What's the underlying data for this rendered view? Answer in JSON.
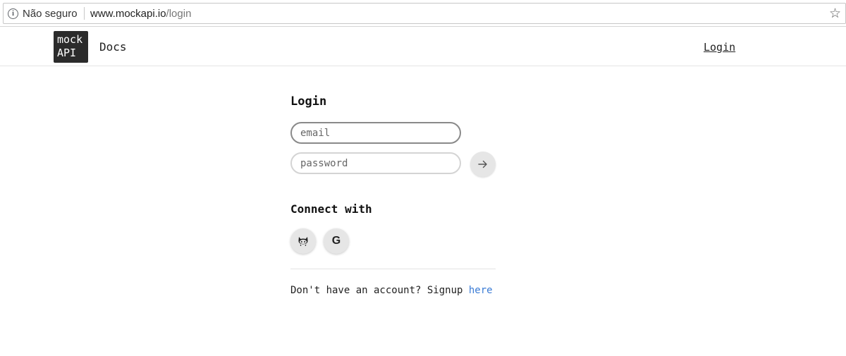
{
  "browser": {
    "security_label": "Não seguro",
    "url_host": "www.mockapi.io",
    "url_path": "/login"
  },
  "header": {
    "logo_line1": "mock",
    "logo_line2": "API",
    "docs_label": "Docs",
    "login_label": "Login"
  },
  "form": {
    "title": "Login",
    "email_placeholder": "email",
    "password_placeholder": "password",
    "submit_icon": "arrow-right-icon"
  },
  "social": {
    "title": "Connect with",
    "github_icon": "github-icon",
    "google_label": "G"
  },
  "signup": {
    "prompt": "Don't have an account? Signup ",
    "link_label": "here",
    "link_color": "#3a7bd5"
  }
}
